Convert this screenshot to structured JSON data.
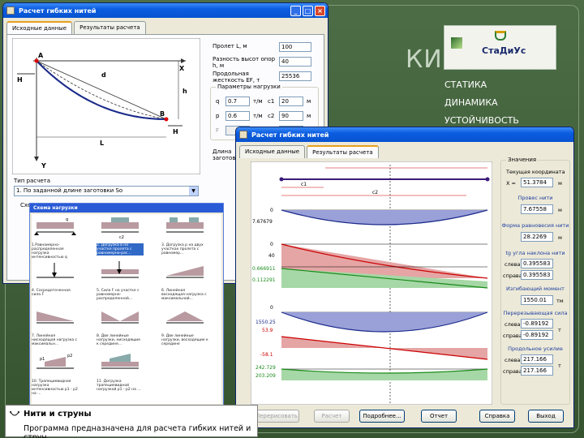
{
  "slide": {
    "title": "КИНЕ",
    "logo_text": "СтаДиУс",
    "list": [
      "СТАТИКА",
      "ДИНАМИКА",
      "УСТОЙЧИВОСТЬ"
    ]
  },
  "win1": {
    "title": "Расчет гибких нитей",
    "tabs": [
      "Исходные данные",
      "Результаты расчета"
    ],
    "diagram_labels": {
      "A": "A",
      "B": "B",
      "H_left": "H",
      "H_right": "H",
      "d": "d",
      "h": "h",
      "X": "X",
      "Y": "Y",
      "L": "L"
    },
    "fields": [
      {
        "label": "Пролет L, м",
        "value": "100"
      },
      {
        "label": "Разность высот опор h, м",
        "value": "40"
      },
      {
        "label": "Продольная жесткость EF, т",
        "value": "25536"
      }
    ],
    "load_group_title": "Параметры нагрузки",
    "load_params": [
      {
        "name": "q",
        "value": "0.7",
        "unit": "т/м",
        "cname": "c1",
        "cvalue": "20",
        "cunit": "м"
      },
      {
        "name": "p",
        "value": "0.6",
        "unit": "т/м",
        "cname": "c2",
        "cvalue": "90",
        "cunit": "м"
      },
      {
        "name": "F",
        "value": "",
        "unit": "т",
        "cname": "c",
        "cvalue": "",
        "cunit": "м"
      }
    ],
    "side_labels": [
      "Длина заготовки"
    ],
    "calc_type_label": "Тип расчета",
    "calc_type_value": "1. По заданной длине заготовки So",
    "scheme_label": "Схем"
  },
  "win2": {
    "title": "Расчет гибких нитей",
    "tabs": [
      "Исходные данные",
      "Результаты расчета"
    ],
    "chart_labels": {
      "c1": "c1",
      "c2": "c2",
      "ticks": [
        "0",
        "7.67679",
        "0",
        "40",
        "0.666911",
        "0.112291",
        "0",
        "1550.25",
        "53.9",
        "-58.1",
        "242.729",
        "203.209"
      ]
    },
    "values_group": "Значения",
    "current_coord_label": "Текущая координата",
    "x_label": "X =",
    "x_value": "51.3784",
    "x_unit": "м",
    "sag_label": "Провес нити",
    "sag_value": "7.67558",
    "sag_unit": "м",
    "shape_label": "Форма равновесия нити",
    "shape_value": "28.2269",
    "shape_unit": "м",
    "tg_label": "tg угла наклона нити",
    "tg_left_label": "слева",
    "tg_left": "0.395583",
    "tg_right_label": "справа",
    "tg_right": "0.395583",
    "moment_label": "Изгибающий момент",
    "moment_value": "1550.01",
    "moment_unit": "тм",
    "shear_label": "Перерезывающая сила",
    "shear_left_label": "слева",
    "shear_left": "-0.89192",
    "shear_right_label": "справа",
    "shear_right": "-0.89192",
    "shear_unit": "т",
    "axial_label": "Продольное усилие",
    "axial_left_label": "слева",
    "axial_left": "217.166",
    "axial_right_label": "справа",
    "axial_right": "217.166",
    "axial_unit": "т",
    "buttons": [
      "Перерисовать",
      "Расчет",
      "Подробнее...",
      "Отчет",
      "Справка",
      "Выход"
    ]
  },
  "scheme": {
    "title": "Схема нагрузки",
    "items": [
      "1.Равномерно-распределенная нагрузка интенсивностью q",
      "2. Догрузка в на участке пролета с равномерно-рас...",
      "3. Догрузка р на двух участках пролета с равномер...",
      "4. Сосредоточенная сила F",
      "5. Сила F на участке с равномерно-распределенной...",
      "6. Линейная восходящая нагрузка с максимальной...",
      "7. Линейная нисходящая нагрузка с максимальн...",
      "8. Две линейные нагрузки, нисходящие к середине...",
      "9. Две линейные нагрузки, восходящие к середине",
      "10. Трапециевидная нагрузка интенсивностью р1 - р2 на ...",
      "11. Догрузка трапециевидной нагрузкой р1 - р2 на ..."
    ]
  },
  "info": {
    "title": "Нити и струны",
    "desc": "Программа предназначена для расчета гибких нитей и струн."
  }
}
